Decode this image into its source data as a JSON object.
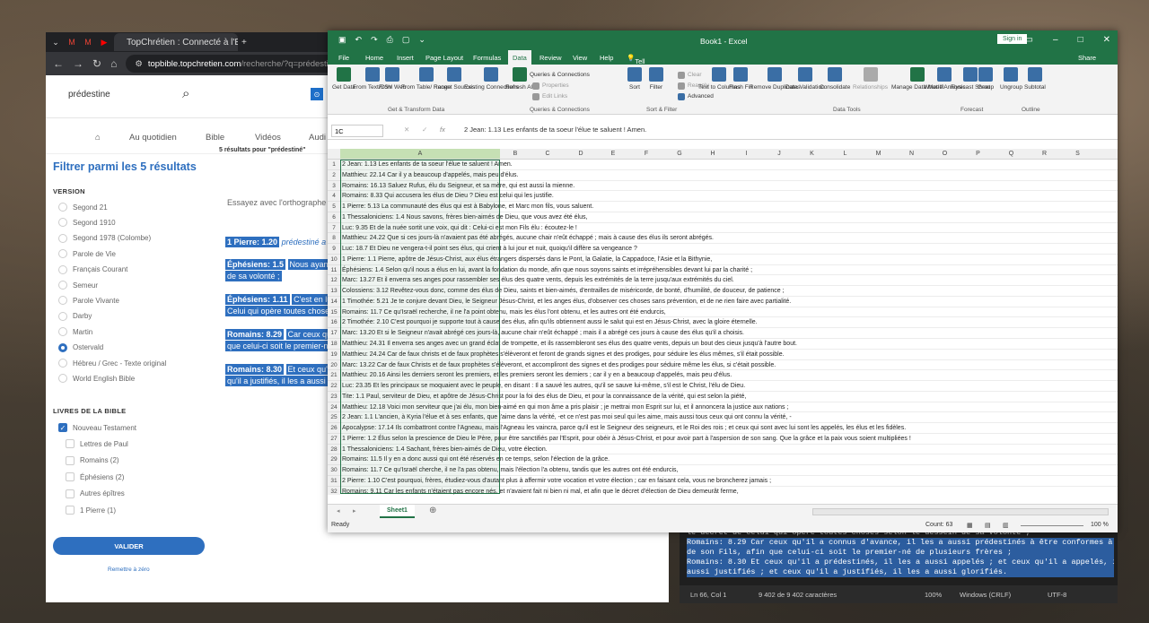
{
  "browser": {
    "tab_title": "TopChrétien : Connecté à l'Esse",
    "url_host": "topbible.topchretien.com",
    "url_path": "/recherche/?q=prédestiné&ver",
    "search_query": "prédestine",
    "nav": [
      "Au quotidien",
      "Bible",
      "Vidéos",
      "Audi"
    ],
    "filter_title": "Filtrer parmi les 5 résultats",
    "version_label": "VERSION",
    "versions": [
      "Segond 21",
      "Segond 1910",
      "Segond 1978 (Colombe)",
      "Parole de Vie",
      "Français Courant",
      "Semeur",
      "Parole Vivante",
      "Darby",
      "Martin",
      "Ostervald",
      "Hébreu / Grec - Texte original",
      "World English Bible"
    ],
    "selected_version": "Ostervald",
    "books_label": "LIVRES DE LA BIBLE",
    "books": [
      "Nouveau Testament",
      "Lettres de Paul",
      "Romains (2)",
      "Éphésiens (2)",
      "Autres épîtres",
      "1 Pierre (1)"
    ],
    "validate": "VALIDER",
    "reset": "Remettre à zéro",
    "result_count": "5 résultats pour \"prédestiné\"",
    "spell": "Essayez avec l'orthographe",
    "results": [
      {
        "ref": "1 Pierre: 1.20",
        "text": "prédestiné a"
      },
      {
        "ref": "Éphésiens: 1.5",
        "text": "Nous ayant",
        "text2": "de sa volonté ;"
      },
      {
        "ref": "Éphésiens: 1.11",
        "text": "C'est en lui",
        "text2": "Celui qui opère toutes chose"
      },
      {
        "ref": "Romains: 8.29",
        "text": "Car ceux qu",
        "text2": "que celui-ci soit le premier-n"
      },
      {
        "ref": "Romains: 8.30",
        "text": "Et ceux qu'i",
        "text2": "qu'il a justifiés, il les a aussi g"
      }
    ]
  },
  "excel": {
    "title": "Book1 - Excel",
    "signin": "Sign in",
    "menu": [
      "File",
      "Home",
      "Insert",
      "Page Layout",
      "Formulas",
      "Data",
      "Review",
      "View",
      "Help",
      "Tell me what you want to do",
      "Share"
    ],
    "active_menu": "Data",
    "ribbon": [
      "Get Data",
      "From Text/CSV",
      "From Web",
      "From Table/ Range",
      "Recent Sources",
      "Existing Connections",
      "Refresh All",
      "Queries & Connections",
      "Properties",
      "Edit Links",
      "Sort",
      "Filter",
      "Clear",
      "Reapply",
      "Advanced",
      "Text to Columns",
      "Flash Fill",
      "Remove Duplicates",
      "Data Validation",
      "Consolidate",
      "Relationships",
      "Manage Data Model",
      "What-If Analysis",
      "Forecast Sheet",
      "Group",
      "Ungroup",
      "Subtotal"
    ],
    "groups": [
      "Get & Transform Data",
      "Queries & Connections",
      "Sort & Filter",
      "Data Tools",
      "Forecast",
      "Outline"
    ],
    "name_box": "1C",
    "fx": "fx",
    "formula": "2 Jean: 1.13 Les enfants de ta soeur l'élue te saluent ! Amen.",
    "columns": [
      "A",
      "B",
      "C",
      "D",
      "E",
      "F",
      "G",
      "H",
      "I",
      "J",
      "K",
      "L",
      "M",
      "N",
      "O",
      "P",
      "Q",
      "R",
      "S"
    ],
    "rows": [
      "2 Jean: 1.13 Les enfants de ta soeur l'élue te saluent ! Amen.",
      "Matthieu: 22.14 Car il y a beaucoup d'appelés, mais peu d'élus.",
      "Romains: 16.13 Saluez Rufus, élu du Seigneur, et sa mère, qui est aussi la mienne.",
      "Romains: 8.33 Qui accusera les élus de Dieu ? Dieu est celui qui les justifie.",
      "1 Pierre: 5.13 La communauté des élus qui est à Babylone, et Marc mon fils, vous saluent.",
      "1 Thessaloniciens: 1.4 Nous savons, frères bien-aimés de Dieu, que vous avez été élus,",
      "Luc: 9.35 Et de la nuée sortit une voix, qui dit : Celui-ci est mon Fils élu : écoutez-le !",
      "Matthieu: 24.22 Que si ces jours-là n'avaient pas été abrégés, aucune chair n'eût échappé ; mais à cause des élus ils seront abrégés.",
      "Luc: 18.7 Et Dieu ne vengera-t-il point ses élus, qui crient à lui jour et nuit, quoiqu'il diffère sa vengeance ?",
      "1 Pierre: 1.1 Pierre, apôtre de Jésus-Christ, aux élus étrangers dispersés dans le Pont, la Galatie, la Cappadoce, l'Asie et la Bithynie,",
      "Éphésiens: 1.4 Selon qu'il nous a élus en lui, avant la fondation du monde, afin que nous soyons saints et irrépréhensibles devant lui par la charité ;",
      "Marc: 13.27 Et il enverra ses anges pour rassembler ses élus des quatre vents, depuis les extrémités de la terre jusqu'aux extrémités du ciel.",
      "Colossiens: 3.12 Revêtez-vous donc, comme des élus de Dieu, saints et bien-aimés, d'entrailles de miséricorde, de bonté, d'humilité, de douceur, de patience ;",
      "1 Timothée: 5.21 Je te conjure devant Dieu, le Seigneur Jésus-Christ, et les anges élus, d'observer ces choses sans prévention, et de ne rien faire avec partialité.",
      "Romains: 11.7 Ce qu'Israël recherche, il ne l'a point obtenu, mais les élus l'ont obtenu, et les autres ont été endurcis,",
      "2 Timothée: 2.10 C'est pourquoi je supporte tout à cause des élus, afin qu'ils obtiennent aussi le salut qui est en Jésus-Christ, avec la gloire éternelle.",
      "Marc: 13.20 Et si le Seigneur n'avait abrégé ces jours-là, aucune chair n'eût échappé ; mais il a abrégé ces jours à cause des élus qu'il a choisis.",
      "Matthieu: 24.31 Il enverra ses anges avec un grand éclat de trompette, et ils rassembleront ses élus des quatre vents, depuis un bout des cieux jusqu'à l'autre bout.",
      "Matthieu: 24.24 Car de faux christs et de faux prophètes s'élèveront et feront de grands signes et des prodiges, pour séduire les élus mêmes, s'il était possible.",
      "Marc: 13.22 Car de faux Christs et de faux prophètes s'élèveront, et accompliront des signes et des prodiges pour séduire même les élus, si c'était possible.",
      "Matthieu: 20.16 Ainsi les derniers seront les premiers, et les premiers seront les derniers ; car il y en a beaucoup d'appelés, mais peu d'élus.",
      "Luc: 23.35 Et les principaux se moquaient avec le peuple, en disant : Il a sauvé les autres, qu'il se sauve lui-même, s'il est le Christ, l'élu de Dieu.",
      "Tite: 1.1 Paul, serviteur de Dieu, et apôtre de Jésus-Christ pour la foi des élus de Dieu, et pour la connaissance de la vérité, qui est selon la piété,",
      "Matthieu: 12.18 Voici mon serviteur que j'ai élu, mon bien-aimé en qui mon âme a pris plaisir ; je mettrai mon Esprit sur lui, et il annoncera la justice aux nations ;",
      "2 Jean: 1.1 L'ancien, à Kyria l'élue et à ses enfants, que j'aime dans la vérité, -et ce n'est pas moi seul qui les aime, mais aussi tous ceux qui ont connu la vérité, -",
      "Apocalypse: 17.14 Ils combattront contre l'Agneau, mais l'Agneau les vaincra, parce qu'il est le Seigneur des seigneurs, et le Roi des rois ; et ceux qui sont avec lui sont les appelés, les élus et les fidèles.",
      "1 Pierre: 1.2 Élus selon la prescience de Dieu le Père, pour être sanctifiés par l'Esprit, pour obéir à Jésus-Christ, et pour avoir part à l'aspersion de son sang. Que la grâce et la paix vous soient multipliées !",
      "1 Thessaloniciens: 1.4 Sachant, frères bien-aimés de Dieu, votre élection.",
      "Romains: 11.5 Il y en a donc aussi qui ont été réservés en ce temps, selon l'élection de la grâce.",
      "Romains: 11.7 Ce qu'Israël cherche, il ne l'a pas obtenu, mais l'élection l'a obtenu, tandis que les autres ont été endurcis,",
      "2 Pierre: 1.10 C'est pourquoi, frères, étudiez-vous d'autant plus à affermir votre vocation et votre élection ; car en faisant cela, vous ne broncherez jamais ;",
      "Romains: 9.11 Car les enfants n'étaient pas encore nés, et n'avaient fait ni bien ni mal, et afin que le décret d'élection de Dieu demeurât ferme,",
      "Romains: 11.28 Il est vrai qu'ils sont ennemis par rapport à l'Évangile, à cause de vous ; mais à l'égard de l'élection, ils sont aimés à cause de leurs pères,"
    ],
    "sheet": "Sheet1",
    "status_ready": "Ready",
    "status_count": "Count: 63",
    "zoom": "100 %"
  },
  "notepad": {
    "lines": [
      "le décret de Celui qui opère toutes choses selon le dessein de sa volonté ;",
      "Romains: 8.29 Car ceux qu'il a connus d'avance, il les a aussi prédestinés à être conformes à l'image",
      "de son Fils, afin que celui-ci soit le premier-né de plusieurs frères ;",
      "Romains: 8.30 Et ceux qu'il a prédestinés, il les a aussi appelés ; et ceux qu'il a appelés, il les a",
      "aussi justifiés ; et ceux qu'il a justifiés, il les a aussi glorifiés."
    ],
    "status": [
      "Ln 66, Col 1",
      "9 402 de 9 402 caractères",
      "100%",
      "Windows (CRLF)",
      "UTF-8"
    ]
  }
}
